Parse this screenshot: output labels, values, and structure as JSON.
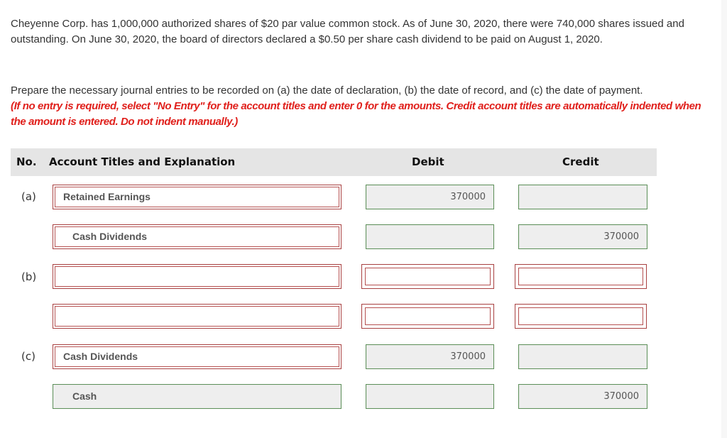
{
  "problem": {
    "statement": "Cheyenne Corp. has 1,000,000 authorized shares of $20 par value common stock. As of June 30, 2020, there were 740,000 shares issued and outstanding. On June 30, 2020, the board of directors declared a $0.50 per share cash dividend to be paid on August 1, 2020.",
    "instruction": "Prepare the necessary journal entries to be recorded on (a) the date of declaration, (b) the date of record, and (c) the date of payment.",
    "warning": "(If no entry is required, select \"No Entry\" for the account titles and enter 0 for the amounts. Credit account titles are automatically indented when the amount is entered. Do not indent manually.)"
  },
  "table": {
    "headers": {
      "no": "No.",
      "account": "Account Titles and Explanation",
      "debit": "Debit",
      "credit": "Credit"
    },
    "rows": [
      {
        "no": "(a)",
        "account": "Retained Earnings",
        "debit": "370000",
        "credit": "",
        "account_status": "incorrect",
        "amount_status": "correct"
      },
      {
        "no": "",
        "account": "Cash Dividends",
        "debit": "",
        "credit": "370000",
        "account_status": "incorrect",
        "amount_status": "correct"
      },
      {
        "no": "(b)",
        "account": "",
        "debit": "",
        "credit": "",
        "account_status": "incorrect",
        "amount_status": "incorrect"
      },
      {
        "no": "",
        "account": "",
        "debit": "",
        "credit": "",
        "account_status": "incorrect",
        "amount_status": "incorrect"
      },
      {
        "no": "(c)",
        "account": "Cash Dividends",
        "debit": "370000",
        "credit": "",
        "account_status": "incorrect",
        "amount_status": "correct"
      },
      {
        "no": "",
        "account": "Cash",
        "debit": "",
        "credit": "370000",
        "account_status": "correct",
        "amount_status": "correct"
      }
    ]
  },
  "colors": {
    "warning_text": "#e0201c",
    "incorrect_border": "#a84040",
    "correct_border": "#5e8f5a",
    "header_bg": "#e5e5e5"
  }
}
